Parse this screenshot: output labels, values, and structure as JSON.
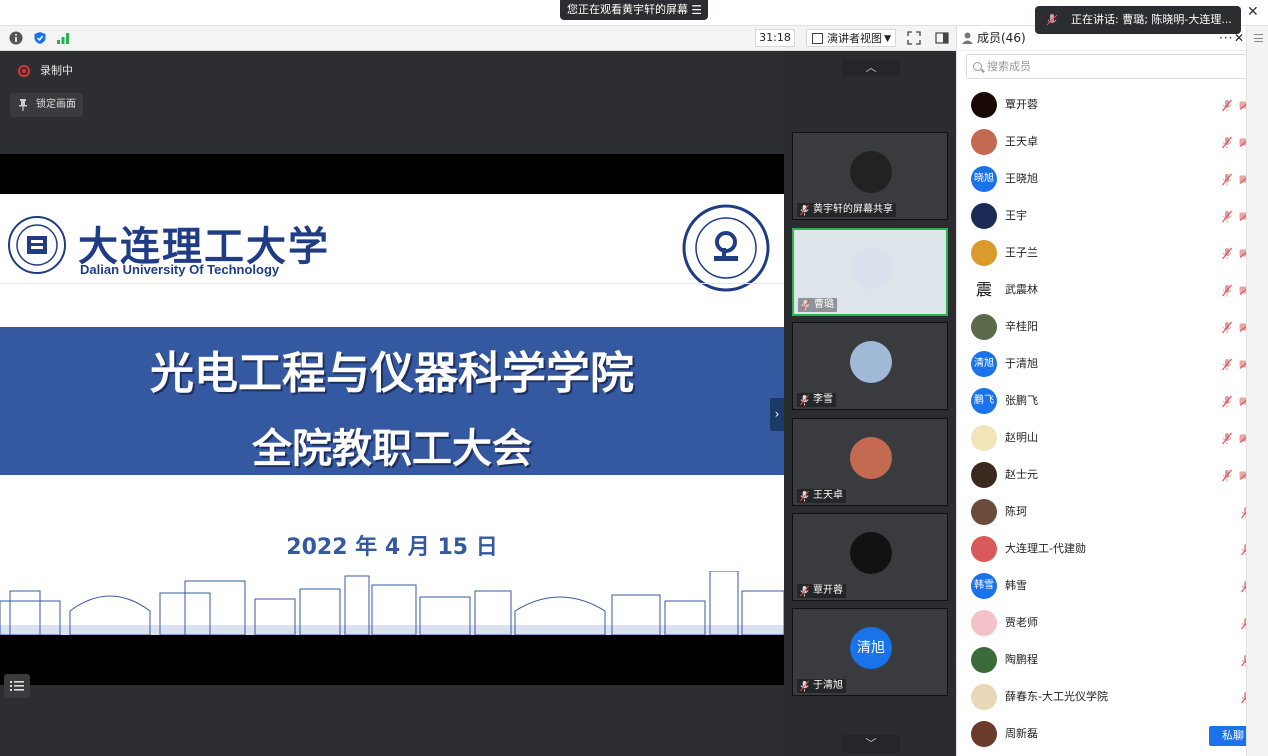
{
  "window": {
    "watching_banner": "您正在观看黄宇轩的屏幕",
    "speaking_toast": "正在讲话: 曹璐; 陈晓明-大连理..."
  },
  "toolbar": {
    "timer": "31:18",
    "view_mode": "演讲者视图"
  },
  "stage": {
    "recording_label": "录制中",
    "lock_screen_label": "锁定画面",
    "slide": {
      "university_cn": "大连理工大学",
      "university_en": "Dalian University Of Technology",
      "heading_1": "光电工程与仪器科学学院",
      "heading_2": "全院教职工大会",
      "date": "2022 年 4 月 15 日"
    }
  },
  "gallery": {
    "tiles": [
      {
        "name": "黄宇轩的屏幕共享",
        "avatar_color": "#222222",
        "avatar_text": ""
      },
      {
        "name": "曹璐",
        "avatar_color": "#d9e2ec",
        "avatar_text": ""
      },
      {
        "name": "李雪",
        "avatar_color": "#9fb9d6",
        "avatar_text": ""
      },
      {
        "name": "王天卓",
        "avatar_color": "#c46a52",
        "avatar_text": ""
      },
      {
        "name": "覃开蓉",
        "avatar_color": "#111111",
        "avatar_text": ""
      },
      {
        "name": "于清旭",
        "avatar_color": "#1a73e8",
        "avatar_text": "清旭"
      }
    ]
  },
  "members": {
    "header": "成员(46)",
    "search_placeholder": "搜索成员",
    "chat_button": "私聊",
    "list": [
      {
        "name": "覃开蓉",
        "avatar_color": "#1a0a05",
        "avatar_text": "",
        "icons": "both"
      },
      {
        "name": "王天卓",
        "avatar_color": "#c46a52",
        "avatar_text": "",
        "icons": "both"
      },
      {
        "name": "王晓旭",
        "avatar_color": "#1a73e8",
        "avatar_text": "晓旭",
        "icons": "both"
      },
      {
        "name": "王宇",
        "avatar_color": "#1b2a55",
        "avatar_text": "",
        "icons": "both"
      },
      {
        "name": "王子兰",
        "avatar_color": "#d99b2b",
        "avatar_text": "",
        "icons": "both"
      },
      {
        "name": "武震林",
        "avatar_color": "#ffffff",
        "avatar_text": "震",
        "icons": "both"
      },
      {
        "name": "辛桂阳",
        "avatar_color": "#5a6a4a",
        "avatar_text": "",
        "icons": "both"
      },
      {
        "name": "于清旭",
        "avatar_color": "#1a73e8",
        "avatar_text": "清旭",
        "icons": "both"
      },
      {
        "name": "张鹏飞",
        "avatar_color": "#1a73e8",
        "avatar_text": "鹏飞",
        "icons": "both"
      },
      {
        "name": "赵明山",
        "avatar_color": "#f0e4b8",
        "avatar_text": "",
        "icons": "both"
      },
      {
        "name": "赵士元",
        "avatar_color": "#3b2a20",
        "avatar_text": "",
        "icons": "both"
      },
      {
        "name": "陈珂",
        "avatar_color": "#6b4b3a",
        "avatar_text": "",
        "icons": "mic"
      },
      {
        "name": "大连理工-代建勋",
        "avatar_color": "#d85a5a",
        "avatar_text": "",
        "icons": "mic"
      },
      {
        "name": "韩雪",
        "avatar_color": "#1a73e8",
        "avatar_text": "韩雪",
        "icons": "mic"
      },
      {
        "name": "贾老师",
        "avatar_color": "#f2c2c8",
        "avatar_text": "",
        "icons": "mic"
      },
      {
        "name": "陶鹏程",
        "avatar_color": "#3a6a3a",
        "avatar_text": "",
        "icons": "mic"
      },
      {
        "name": "薛春东-大工光仪学院",
        "avatar_color": "#e8d8b8",
        "avatar_text": "",
        "icons": "mic"
      },
      {
        "name": "周新磊",
        "avatar_color": "#6a3a2a",
        "avatar_text": "",
        "icons": "none"
      }
    ]
  }
}
